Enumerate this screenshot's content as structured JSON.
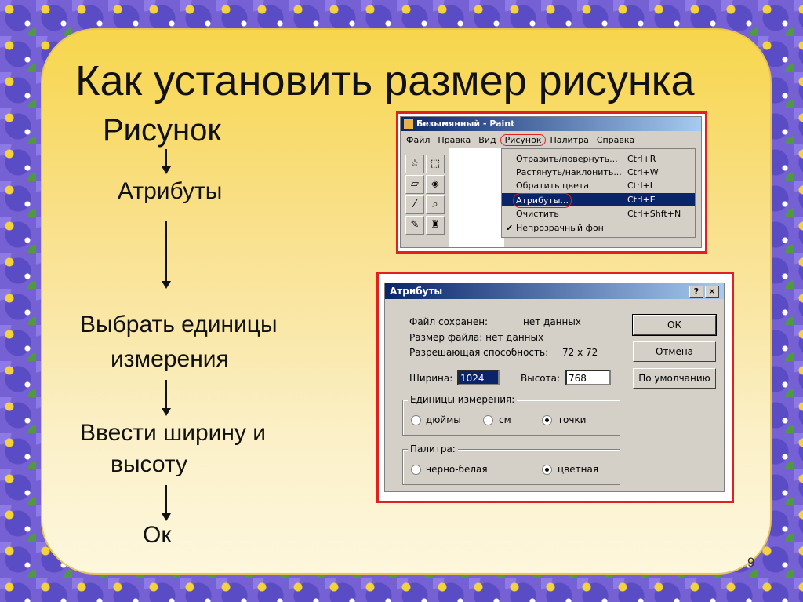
{
  "slide": {
    "title": "Как установить размер рисунка",
    "subtitle": "Рисунок",
    "steps": [
      "Атрибуты",
      "Выбрать единицы",
      "измерения",
      "Ввести ширину и",
      "высоту",
      "Ок"
    ],
    "page_number": "9"
  },
  "paint_window": {
    "title": "Безымянный - Paint",
    "menu": [
      "Файл",
      "Правка",
      "Вид",
      "Рисунок",
      "Палитра",
      "Справка"
    ],
    "dropdown": [
      {
        "label": "Отразить/повернуть...",
        "shortcut": "Ctrl+R"
      },
      {
        "label": "Растянуть/наклонить...",
        "shortcut": "Ctrl+W"
      },
      {
        "label": "Обратить цвета",
        "shortcut": "Ctrl+I"
      },
      {
        "label": "Атрибуты...",
        "shortcut": "Ctrl+E"
      },
      {
        "label": "Очистить",
        "shortcut": "Ctrl+Shft+N"
      },
      {
        "label": "Непрозрачный фон",
        "shortcut": ""
      }
    ]
  },
  "attributes_dialog": {
    "title": "Атрибуты",
    "help_button": "?",
    "close_button": "✕",
    "file_saved_label": "Файл сохранен:",
    "file_saved_value": "нет данных",
    "file_size_label": "Размер файла: нет данных",
    "resolution_label": "Разрешающая способность:",
    "resolution_value": "72 x 72",
    "width_label": "Ширина:",
    "width_value": "1024",
    "height_label": "Высота:",
    "height_value": "768",
    "units_group": "Единицы измерения:",
    "units": [
      "дюймы",
      "см",
      "точки"
    ],
    "palette_group": "Палитра:",
    "palette": [
      "черно-белая",
      "цветная"
    ],
    "ok": "ОК",
    "cancel": "Отмена",
    "default": "По умолчанию"
  }
}
